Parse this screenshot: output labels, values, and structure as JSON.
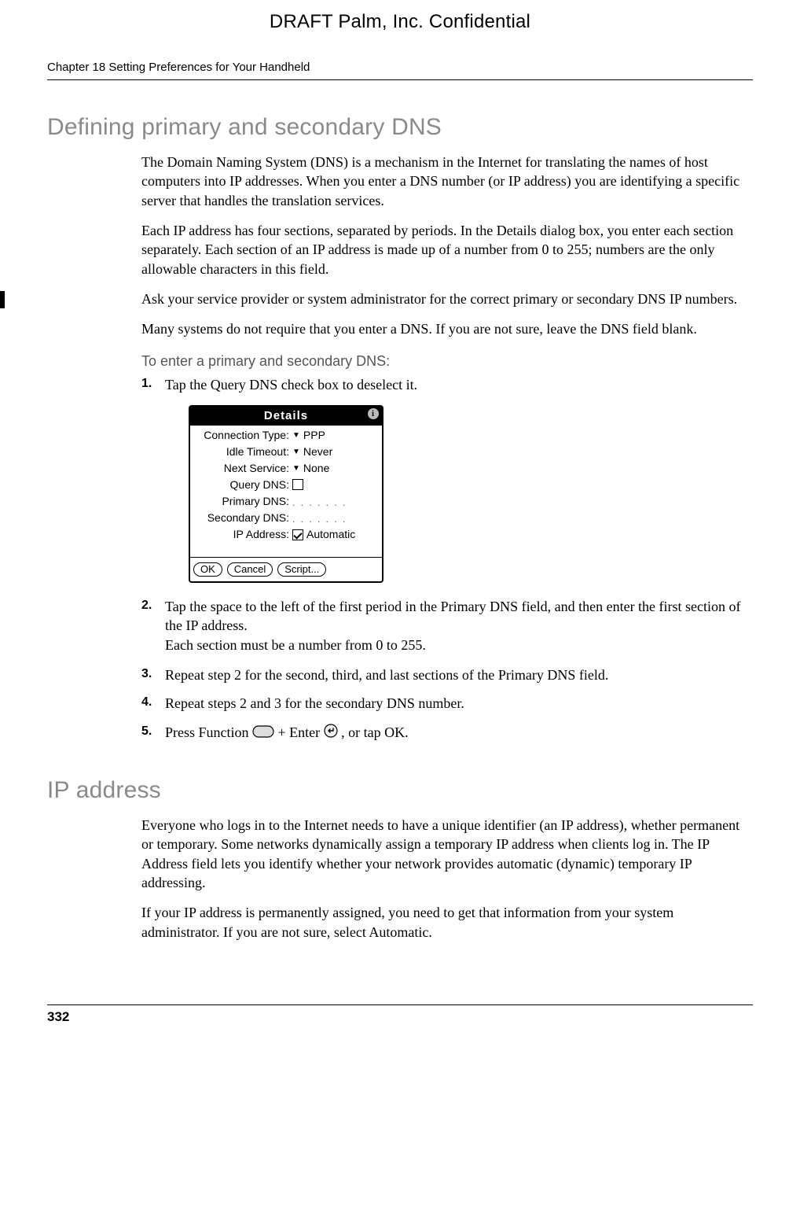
{
  "header": {
    "draft": "DRAFT   Palm, Inc. Confidential"
  },
  "chapter": {
    "line": "Chapter 18   Setting Preferences for Your Handheld"
  },
  "section1": {
    "heading": "Defining primary and secondary DNS",
    "p1": "The Domain Naming System (DNS) is a mechanism in the Internet for translating the names of host computers into IP addresses. When you enter a DNS number (or IP address) you are identifying a specific server that handles the translation services.",
    "p2": "Each IP address has four sections, separated by periods. In the Details dialog box, you enter each section separately. Each section of an IP address is made up of a number from 0 to 255; numbers are the only allowable characters in this field.",
    "p3": "Ask your service provider or system administrator for the correct primary or secondary DNS IP numbers.",
    "p4": "Many systems do not require that you enter a DNS. If you are not sure, leave the DNS field blank.",
    "subheading": "To enter a primary and secondary DNS:",
    "steps": {
      "s1": "Tap the Query DNS check box to deselect it.",
      "s2": "Tap the space to the left of the first period in the Primary DNS field, and then enter the first section of the IP address.",
      "s2sub": "Each section must be a number from 0 to 255.",
      "s3": "Repeat step 2 for the second, third, and last sections of the Primary DNS field.",
      "s4": "Repeat steps 2 and 3 for the secondary DNS number.",
      "s5a": "Press Function ",
      "s5b": " + Enter ",
      "s5c": ", or tap OK."
    },
    "markers": {
      "m1": "1.",
      "m2": "2.",
      "m3": "3.",
      "m4": "4.",
      "m5": "5."
    }
  },
  "device": {
    "title": "Details",
    "rows": {
      "conn_label": "Connection Type:",
      "conn_val": "PPP",
      "idle_label": "Idle Timeout:",
      "idle_val": "Never",
      "next_label": "Next Service:",
      "next_val": "None",
      "qdns_label": "Query DNS:",
      "pdns_label": "Primary DNS:",
      "sdns_label": "Secondary DNS:",
      "ip_label": "IP Address:",
      "ip_val": "Automatic"
    },
    "blank_dots": ".   .   .   .   .   .   .",
    "buttons": {
      "ok": "OK",
      "cancel": "Cancel",
      "script": "Script..."
    }
  },
  "section2": {
    "heading": "IP address",
    "p1": "Everyone who logs in to the Internet needs to have a unique identifier (an IP address), whether permanent or temporary. Some networks dynamically assign a temporary IP address when clients log in. The IP Address field lets you identify whether your network provides automatic (dynamic) temporary IP addressing.",
    "p2": "If your IP address is permanently assigned, you need to get that information from your system administrator. If you are not sure, select Automatic."
  },
  "footer": {
    "page": "332"
  }
}
